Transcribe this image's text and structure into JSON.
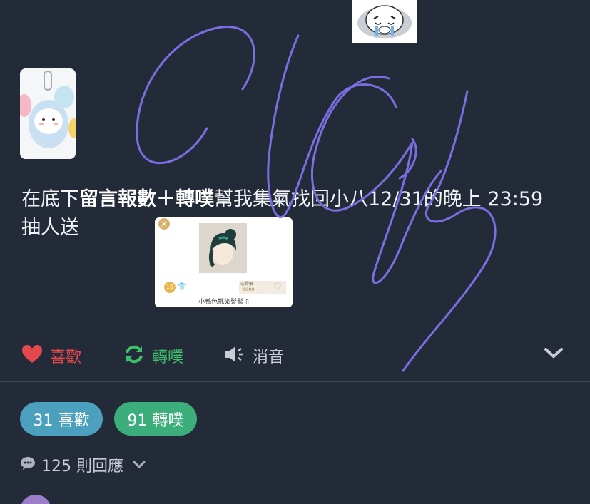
{
  "post": {
    "text_before": "在底下",
    "text_bold": "留言報數＋轉噗",
    "text_after": "幫我集氣找回小八12/31的晚上 23:59 抽人送"
  },
  "item_card": {
    "close": "×",
    "coin": "10",
    "price_label": "心得數",
    "price_value": "8000",
    "heart": "♡",
    "name": "小鴨色挑染髮髻 ▯"
  },
  "actions": {
    "like": {
      "label": "喜歡",
      "icon": "heart-icon",
      "color": "#e4484d"
    },
    "repost": {
      "label": "轉噗",
      "icon": "repost-icon",
      "color": "#3fbf6b"
    },
    "mute": {
      "label": "消音",
      "icon": "speaker-icon",
      "color": "#c9ccd3"
    }
  },
  "stats": {
    "likes": "31 喜歡",
    "reposts": "91 轉噗"
  },
  "comments": {
    "label": "125 則回應"
  },
  "colors": {
    "background": "#232a38",
    "scribble": "#7b6ee0"
  }
}
